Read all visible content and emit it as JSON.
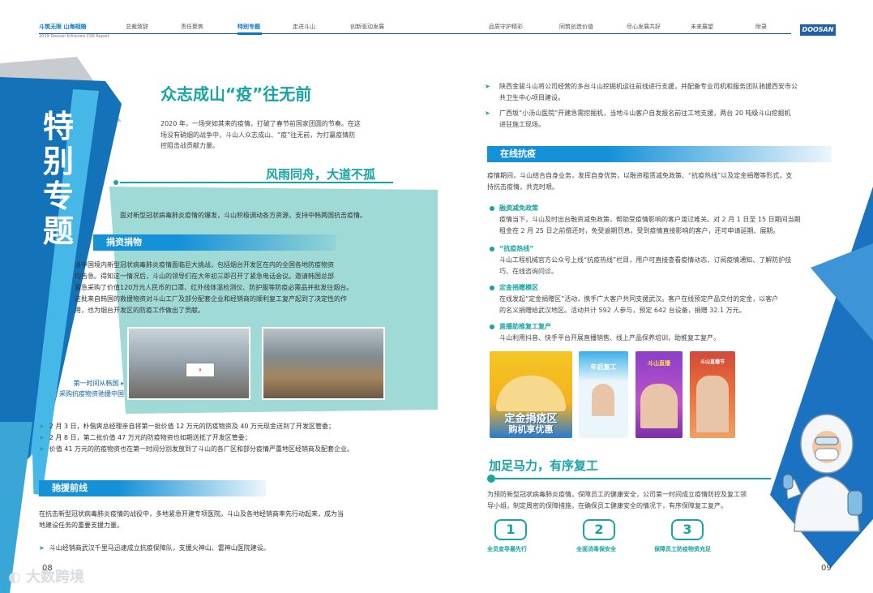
{
  "header": {
    "brand": "斗筑无限 山海相随",
    "report": "2019 Doosan Infracore CSR Report",
    "logo": "DOOSAN",
    "nav": [
      "总裁致辞",
      "责任聚焦",
      "特别专题",
      "走进斗山",
      "创新驱动发展",
      "品质守护精彩",
      "同筑创造价值",
      "尽心发展共好",
      "未来展望",
      "附录"
    ]
  },
  "left": {
    "spine_title": "特别专题",
    "title": "众志成山“疫”往无前",
    "intro": [
      "2020 年，一场突如其来的疫情，打破了春节前国家团圆的节奏。在这",
      "场没有硝烟的战争中，斗山人众志成山、“疫”往无前，为打赢疫情防",
      "控阻击战贡献力量。"
    ],
    "subtitle": "风雨同舟，大道不孤",
    "support": "面对新型冠状病毒肺炎疫情的爆发，斗山积极调动各方资源，支持中韩两国抗击疫情。",
    "donation_h": "捐资捐物",
    "donation_text": [
      "当中国境内新型冠状病毒肺炎疫情面临巨大挑战，包括烟台开发区在内的全国各地防疫物资",
      "均告急。得知这一情况后，斗山的领导们在大年初三即召开了紧急电话会议。邀请韩国总部",
      "紧急采购了价值120万元人民币的口罩、红外线体温检测仪、防护服等防疫必需品并批发往烟台。",
      "这批来自韩国的救援物资对斗山工厂及部分配套企业和经销商的顺利复工复产起到了决定性的作",
      "用，也为烟台开发区的防疫工作做出了贡献。"
    ],
    "caption": [
      "第一时间从韩国",
      "采购抗疫物资驰援中国"
    ],
    "bullets": [
      "2 月 3 日，朴偕爽总经理亲自将第一批价值 12 万元的防疫物资及 40 万元现金送到了开发区管委；",
      "2 月 8 日，第二批价值 47 万元的防疫物资也如期送抵了开发区管委；",
      "价值 41 万元的防疫物资也在第一时间分别发放到了斗山的各厂区和部分疫情严重地区经销商及配套企业。"
    ],
    "rescue_h": "驰援前线",
    "rescue_text": [
      "在抗击新型冠状病毒肺炎疫情的战役中，多地紧急开建专项医院。斗山及各地经销商率先行动起来，成为当",
      "地建设任务的重要支援力量。"
    ],
    "rescue_bullet": "斗山经销商武汉千里马迅速成立抗疫保障队，支援火神山、雷神山医院建设。",
    "page": "08",
    "watermark": "大数跨境"
  },
  "right": {
    "bullets_top": [
      [
        "陕西金骏斗山将公司经营的多台斗山挖掘机运往前线进行支援，并配备专业司机和服务团队驰援西安市公",
        "共卫生中心项目建设。"
      ],
      [
        "广西坂“小汤山医院”开建急需挖掘机，当地斗山客户自发报名前往工地支援，两台 20 吨级斗山挖掘机",
        "进驻施工现场。"
      ]
    ],
    "online_h": "在线抗疫",
    "online_text": [
      "疫情期间，斗山结合自身业务，发挥自身优势，以融资租赁减免政策、“抗疫热线”以及定金捐赠等形式，支",
      "持抗击疫情，共克时艰。"
    ],
    "items": [
      {
        "h": "融资减免政策",
        "text": [
          "疫情当下，斗山及时出台融资减免政策，帮助受疫情影响的客户渡过难关。对 2 月 1 日至 15 日期间当期",
          "租金在 2 月 25 日之前偿还时，免受逾期罚息，受到疫情直接影响的客户，还可申请延期、展期。"
        ]
      },
      {
        "h": "“抗疫热线”",
        "text": [
          "斗山工程机械官方公众号上线“抗疫热线”栏目，用户可直接查看疫情动态、订阅疫情通知、了解防护技",
          "巧、在线咨询问诊。"
        ]
      },
      {
        "h": "定金捐赠模区",
        "text": [
          "在线发起“定金捐赠区”活动，携手广大客户共同支援武汉。客户在线预定产品交付的定金，以客户",
          "的名义捐赠给武汉地区。活动共计 592 人参与，预定 642 台设备，捐赠 32.1 万元。"
        ]
      },
      {
        "h": "直播助推复工复产",
        "text": [
          "斗山利用抖音、快手平台开展直播销售、线上产品保养培训，助推复工复产。"
        ]
      }
    ],
    "poster1": [
      "定金捐疫区",
      "购机享优惠"
    ],
    "poster2": "年后复工",
    "poster3": "斗山直播",
    "poster4": "斗山直播节",
    "resume_h": "加足马力，有序复工",
    "resume_text": [
      "为预防新型冠状病毒肺炎疫情，保障员工的健康安全，公司第一时间成立疫情防控及复工领",
      "导小组，制定周密的保障措施，在确保员工健康安全的情况下，有序保障复工复产。"
    ],
    "steps": [
      {
        "n": "1",
        "label": "全员宣导最先行"
      },
      {
        "n": "2",
        "label": "全面消毒保安全"
      },
      {
        "n": "3",
        "label": "保障员工防疫物资充足"
      }
    ],
    "page": "09"
  }
}
